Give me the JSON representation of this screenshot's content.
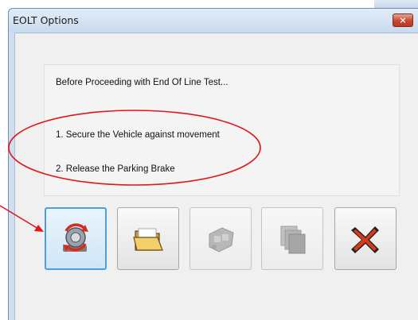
{
  "window": {
    "title": "EOLT Options",
    "close_label": "×"
  },
  "instructions": {
    "heading": "Before Proceeding with End Of Line Test...",
    "step1": "1. Secure the Vehicle against movement",
    "step2": "2. Release the Parking Brake"
  },
  "buttons": [
    {
      "name": "start-eol-test-button",
      "icon": "engine-refresh-icon",
      "state": "selected"
    },
    {
      "name": "open-folder-button",
      "icon": "folder-icon",
      "state": "enabled"
    },
    {
      "name": "engine-module-button",
      "icon": "engine-block-icon",
      "state": "disabled"
    },
    {
      "name": "copy-pages-button",
      "icon": "pages-stack-icon",
      "state": "disabled"
    },
    {
      "name": "cancel-button",
      "icon": "red-x-icon",
      "state": "enabled"
    }
  ],
  "colors": {
    "annotation": "#e0161b",
    "focus_border": "#4a9fe0",
    "close_button": "#c9462e"
  }
}
